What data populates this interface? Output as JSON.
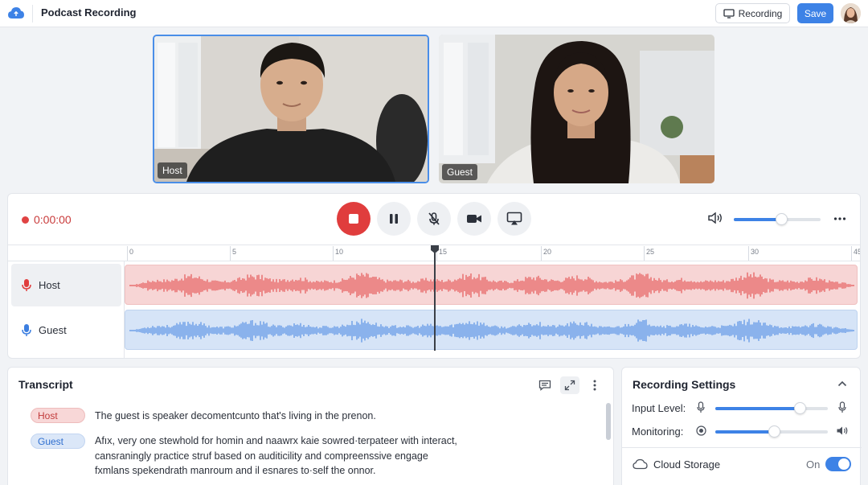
{
  "app": {
    "title": "Podcast Recording"
  },
  "header": {
    "recording_button_label": "Recording",
    "save_button_label": "Save"
  },
  "participants": [
    {
      "label": "Host",
      "highlighted": true
    },
    {
      "label": "Guest",
      "highlighted": false
    }
  ],
  "recorder": {
    "timer": "0:00:00",
    "volume_level": 0.55,
    "playhead_seconds": 14.5,
    "timeline_ticks": [
      "0",
      "5",
      "10",
      "15",
      "20",
      "25",
      "30",
      "45"
    ],
    "tracks": [
      {
        "name": "Host",
        "color": "#e03d3d"
      },
      {
        "name": "Guest",
        "color": "#3d7fe0"
      }
    ]
  },
  "transcript": {
    "title": "Transcript",
    "entries": [
      {
        "speaker": "Host",
        "text": "The guest is speaker decomentcunto that's living in the prenon."
      },
      {
        "speaker": "Guest",
        "text": "Afıx, very one stewhold for homin and naawrx kaie sowred·terpateer with interact, cansraningly practice struf based on auditicility and compreenssive engage fxmlans spekendrath manroum and il esnares to·self the onnor."
      }
    ]
  },
  "settings": {
    "title": "Recording Settings",
    "input_level_label": "Input Level:",
    "input_level": 0.75,
    "monitoring_label": "Monitoring:",
    "monitoring_level": 0.52,
    "cloud_storage_label": "Cloud Storage",
    "cloud_storage_state": "On"
  },
  "colors": {
    "accent": "#3d82e6",
    "record": "#e03d3d",
    "host_wave": "#e03d3d",
    "guest_wave": "#3d7fe0"
  }
}
